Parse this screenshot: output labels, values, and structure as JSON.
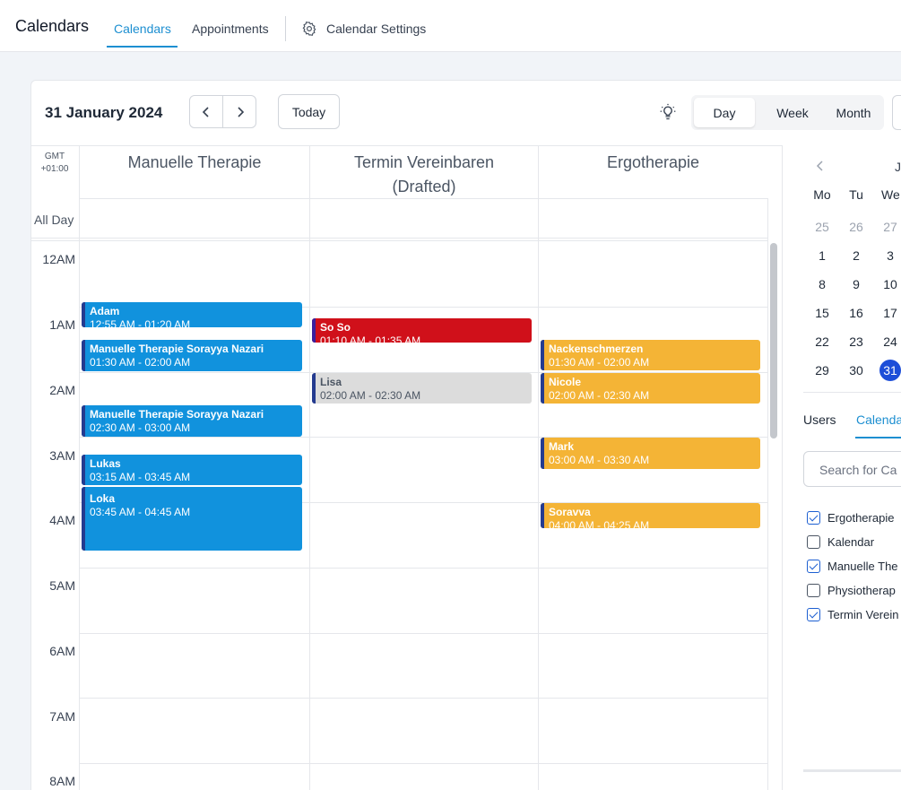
{
  "topbar": {
    "app_title": "Calendars",
    "tabs": [
      {
        "label": "Calendars",
        "active": true
      },
      {
        "label": "Appointments",
        "active": false
      }
    ],
    "settings_label": "Calendar Settings"
  },
  "toolbar": {
    "date_title": "31 January 2024",
    "today_label": "Today",
    "views": [
      {
        "label": "Day",
        "active": true
      },
      {
        "label": "Week",
        "active": false
      },
      {
        "label": "Month",
        "active": false
      }
    ]
  },
  "grid": {
    "timezone_line1": "GMT",
    "timezone_line2": "+01:00",
    "all_day_label": "All Day",
    "columns": [
      {
        "title": "Manuelle Therapie"
      },
      {
        "title": "Termin Vereinbaren (Drafted)"
      },
      {
        "title": "Ergotherapie"
      }
    ],
    "hours": [
      "12AM",
      "1AM",
      "2AM",
      "3AM",
      "4AM",
      "5AM",
      "6AM",
      "7AM",
      "8AM"
    ]
  },
  "events": [
    {
      "title": "Adam",
      "time": "12:55 AM - 01:20 AM",
      "color": "#1192dd"
    },
    {
      "title": "Manuelle Therapie Sorayya Nazari",
      "time": "01:30 AM - 02:00 AM",
      "color": "#1192dd"
    },
    {
      "title": "Manuelle Therapie Sorayya Nazari",
      "time": "02:30 AM - 03:00 AM",
      "color": "#1192dd"
    },
    {
      "title": "Lukas",
      "time": "03:15 AM - 03:45 AM",
      "color": "#1192dd"
    },
    {
      "title": "Loka",
      "time": "03:45 AM - 04:45 AM",
      "color": "#1192dd"
    },
    {
      "title": "So So",
      "time": "01:10 AM - 01:35 AM",
      "color": "#d0101a"
    },
    {
      "title": "Lisa",
      "time": "02:00 AM - 02:30 AM",
      "color": "#dcdcdc"
    },
    {
      "title": "Nackenschmerzen",
      "time": "01:30 AM - 02:00 AM",
      "color": "#f4b436"
    },
    {
      "title": "Nicole",
      "time": "02:00 AM - 02:30 AM",
      "color": "#f4b436"
    },
    {
      "title": "Mark",
      "time": "03:00 AM - 03:30 AM",
      "color": "#f4b436"
    },
    {
      "title": "Soravva",
      "time": "04:00 AM - 04:25 AM",
      "color": "#f4b436"
    }
  ],
  "mini_calendar": {
    "month_label": "J",
    "weekdays": [
      "Mo",
      "Tu",
      "We"
    ],
    "weeks": [
      [
        "25",
        "26",
        "27"
      ],
      [
        "1",
        "2",
        "3"
      ],
      [
        "8",
        "9",
        "10"
      ],
      [
        "15",
        "16",
        "17"
      ],
      [
        "22",
        "23",
        "24"
      ],
      [
        "29",
        "30",
        "31"
      ]
    ],
    "selected": "31"
  },
  "sidebar": {
    "tabs": [
      {
        "label": "Users",
        "active": false
      },
      {
        "label": "Calenda",
        "active": true
      }
    ],
    "search_placeholder": "Search for Ca",
    "calendars": [
      {
        "label": "Ergotherapie",
        "checked": true
      },
      {
        "label": "Kalendar",
        "checked": false
      },
      {
        "label": "Manuelle The",
        "checked": true
      },
      {
        "label": "Physiotherap",
        "checked": false
      },
      {
        "label": "Termin Verein",
        "checked": true
      }
    ]
  }
}
